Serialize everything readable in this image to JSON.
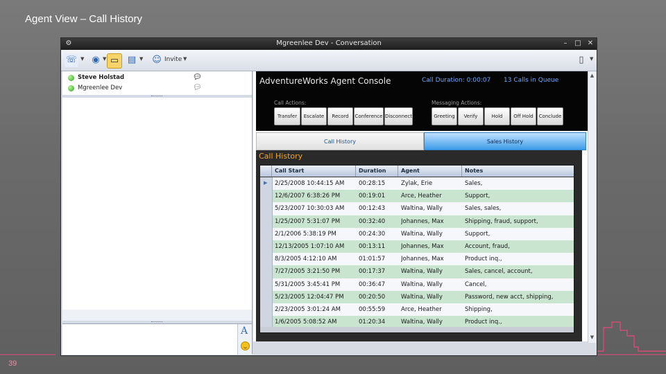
{
  "slide": {
    "title": "Agent View – Call History",
    "number": "39"
  },
  "window": {
    "title": "Mgreenlee Dev - Conversation",
    "controls": {
      "minimize": "–",
      "maximize": "□",
      "close": "✕"
    },
    "toolbar": {
      "invite_label": "Invite"
    }
  },
  "participants": [
    {
      "name": "Steve Holstad"
    },
    {
      "name": "Mgreenlee Dev"
    }
  ],
  "compose": {
    "font_label": "A"
  },
  "console": {
    "title": "AdventureWorks Agent Console",
    "call_duration": "Call Duration: 0:00:07",
    "calls_in_queue": "13 Calls in Queue",
    "call_actions_label": "Call Actions:",
    "messaging_actions_label": "Messaging Actions:",
    "call_actions": [
      "Transfer",
      "Escalate",
      "Record",
      "Conference",
      "Disconnect"
    ],
    "messaging_actions": [
      "Greeting",
      "Verify",
      "Hold",
      "Off Hold",
      "Conclude"
    ],
    "tabs": [
      "Call History",
      "Sales History"
    ],
    "history_title": "Call History",
    "columns": [
      "Call Start",
      "Duration",
      "Agent",
      "Notes"
    ],
    "rows": [
      {
        "start": "2/25/2008 10:44:15 AM",
        "duration": "00:28:15",
        "agent": "Zylak, Erie",
        "notes": "Sales,"
      },
      {
        "start": "12/6/2007 6:38:26 PM",
        "duration": "00:19:01",
        "agent": "Arce, Heather",
        "notes": "Support,"
      },
      {
        "start": "5/23/2007 10:30:03 AM",
        "duration": "00:12:43",
        "agent": "Waltina, Wally",
        "notes": "Sales, sales,"
      },
      {
        "start": "1/25/2007 5:31:07 PM",
        "duration": "00:32:40",
        "agent": "Johannes, Max",
        "notes": "Shipping, fraud, support,"
      },
      {
        "start": "2/1/2006 5:38:19 PM",
        "duration": "00:24:30",
        "agent": "Waltina, Wally",
        "notes": "Support,"
      },
      {
        "start": "12/13/2005 1:07:10 AM",
        "duration": "00:13:11",
        "agent": "Johannes, Max",
        "notes": "Account, fraud,"
      },
      {
        "start": "8/3/2005 4:12:10 AM",
        "duration": "01:01:57",
        "agent": "Johannes, Max",
        "notes": "Product inq.,"
      },
      {
        "start": "7/27/2005 3:21:50 PM",
        "duration": "00:17:37",
        "agent": "Waltina, Wally",
        "notes": "Sales, cancel, account,"
      },
      {
        "start": "5/31/2005 3:45:41 PM",
        "duration": "00:36:47",
        "agent": "Waltina, Wally",
        "notes": "Cancel,"
      },
      {
        "start": "5/23/2005 12:04:47 PM",
        "duration": "00:20:50",
        "agent": "Waltina, Wally",
        "notes": "Password, new acct, shipping,"
      },
      {
        "start": "2/23/2005 3:01:24 AM",
        "duration": "00:55:59",
        "agent": "Arce, Heather",
        "notes": "Shipping,"
      },
      {
        "start": "1/6/2005 5:08:52 AM",
        "duration": "01:20:34",
        "agent": "Waltina, Wally",
        "notes": "Product inq.,"
      }
    ]
  },
  "colors": {
    "accent_pink": "#e8497a",
    "queue_blue": "#6aa8ff",
    "history_orange": "#f2a52a",
    "row_green": "#c9e4cf"
  },
  "icons": {
    "toolbar": [
      "phone-icon",
      "video-icon",
      "im-icon",
      "share-icon",
      "invite-icon",
      "document-icon"
    ]
  }
}
